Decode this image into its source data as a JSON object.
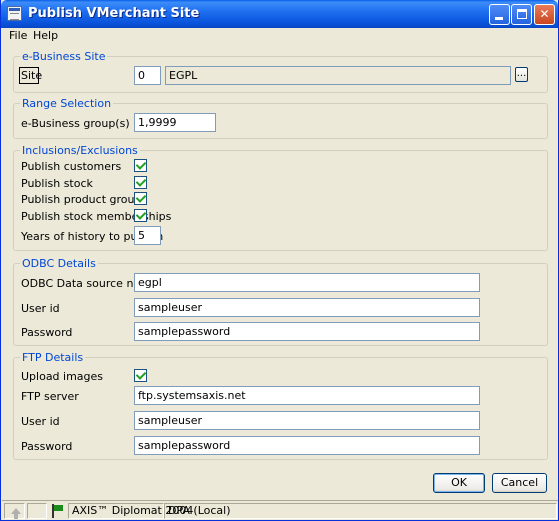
{
  "window": {
    "title": "Publish VMerchant Site"
  },
  "menu": {
    "file": "File",
    "help": "Help"
  },
  "ebusiness_site": {
    "legend": "e-Business Site",
    "site_label": "Site",
    "site_code": "0",
    "site_name": "EGPL",
    "browse_label": "..."
  },
  "range_selection": {
    "legend": "Range Selection",
    "groups_label": "e-Business group(s)",
    "groups_value": "1,9999"
  },
  "inclusions": {
    "legend": "Inclusions/Exclusions",
    "publish_customers": {
      "label": "Publish customers",
      "checked": true
    },
    "publish_stock": {
      "label": "Publish stock",
      "checked": true
    },
    "publish_product_groups": {
      "label": "Publish product groups",
      "checked": true
    },
    "publish_stock_memberships": {
      "label": "Publish stock memberships",
      "checked": true
    },
    "years_label": "Years of history to publish",
    "years_value": "5"
  },
  "odbc": {
    "legend": "ODBC Details",
    "dsn_label": "ODBC Data source name",
    "dsn_value": "egpl",
    "user_label": "User id",
    "user_value": "sampleuser",
    "password_label": "Password",
    "password_value": "samplepassword"
  },
  "ftp": {
    "legend": "FTP Details",
    "upload_images": {
      "label": "Upload images",
      "checked": true
    },
    "server_label": "FTP server",
    "server_value": "ftp.systemsaxis.net",
    "user_label": "User id",
    "user_value": "sampleuser",
    "password_label": "Password",
    "password_value": "samplepassword"
  },
  "buttons": {
    "ok": "OK",
    "cancel": "Cancel"
  },
  "status": {
    "product": "AXIS™ Diplomat 2004",
    "connection": "DPA (Local)"
  },
  "colors": {
    "titlebar": "#0a55dd",
    "legend": "#0046d5",
    "checkmark": "#21a121",
    "window_bg": "#ece9d8"
  }
}
